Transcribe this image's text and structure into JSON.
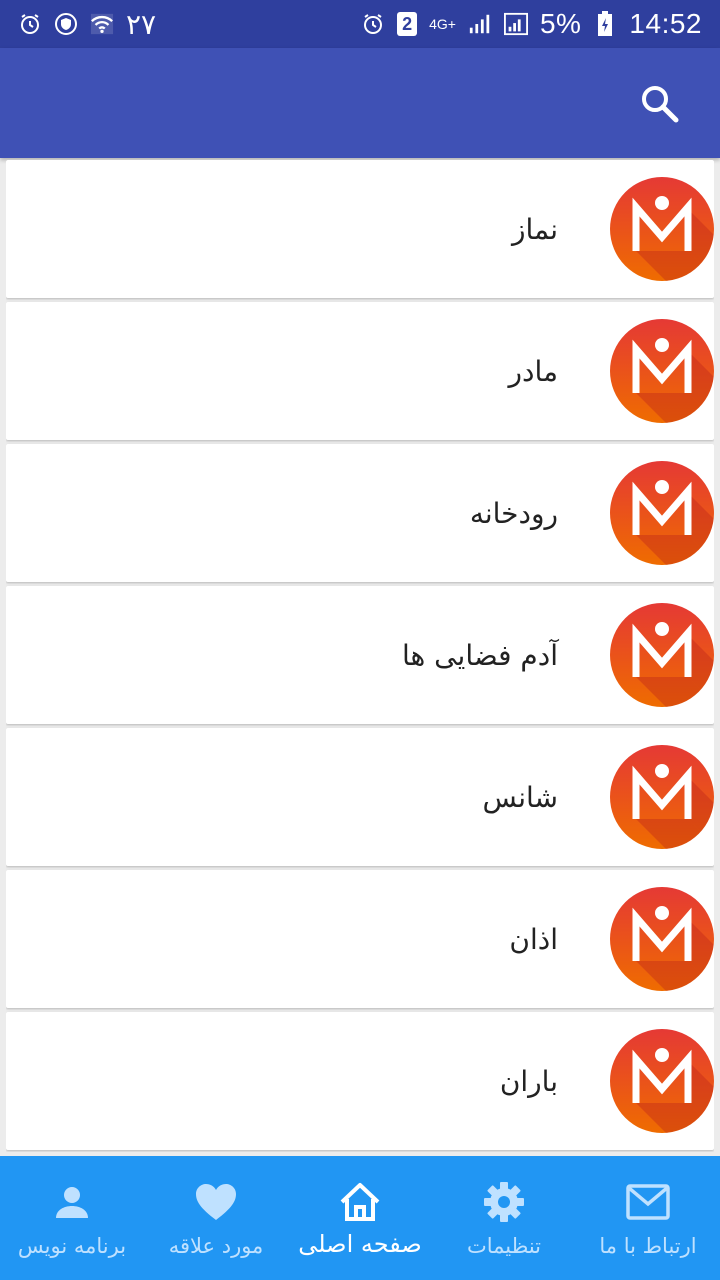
{
  "status_bar": {
    "left_number": "۲۷",
    "battery_percent": "5%",
    "time": "14:52",
    "network": "4G+",
    "sim_badge": "2",
    "icons": [
      "alarm-icon",
      "shield-icon",
      "wifi-icon",
      "alarm-icon",
      "sim-badge-icon",
      "signal-icon",
      "battery-icon"
    ]
  },
  "app_bar": {
    "search_icon": "search-icon"
  },
  "list": {
    "items": [
      {
        "title": "نماز"
      },
      {
        "title": "مادر"
      },
      {
        "title": "رودخانه"
      },
      {
        "title": "آدم فضایی ها"
      },
      {
        "title": "شانس"
      },
      {
        "title": "اذان"
      },
      {
        "title": "باران"
      }
    ]
  },
  "bottom_nav": {
    "items": [
      {
        "label": "برنامه نویس",
        "icon": "person-icon",
        "active": false
      },
      {
        "label": "مورد علاقه",
        "icon": "heart-icon",
        "active": false
      },
      {
        "label": "صفحه اصلی",
        "icon": "home-icon",
        "active": true
      },
      {
        "label": "تنظیمات",
        "icon": "gear-icon",
        "active": false
      },
      {
        "label": "ارتباط با ما",
        "icon": "mail-icon",
        "active": false
      }
    ]
  },
  "colors": {
    "status_bar": "#2f3f9e",
    "app_bar": "#3f51b5",
    "bottom_nav": "#2196f3",
    "logo_red": "#e53935",
    "logo_orange": "#ef6c00"
  }
}
